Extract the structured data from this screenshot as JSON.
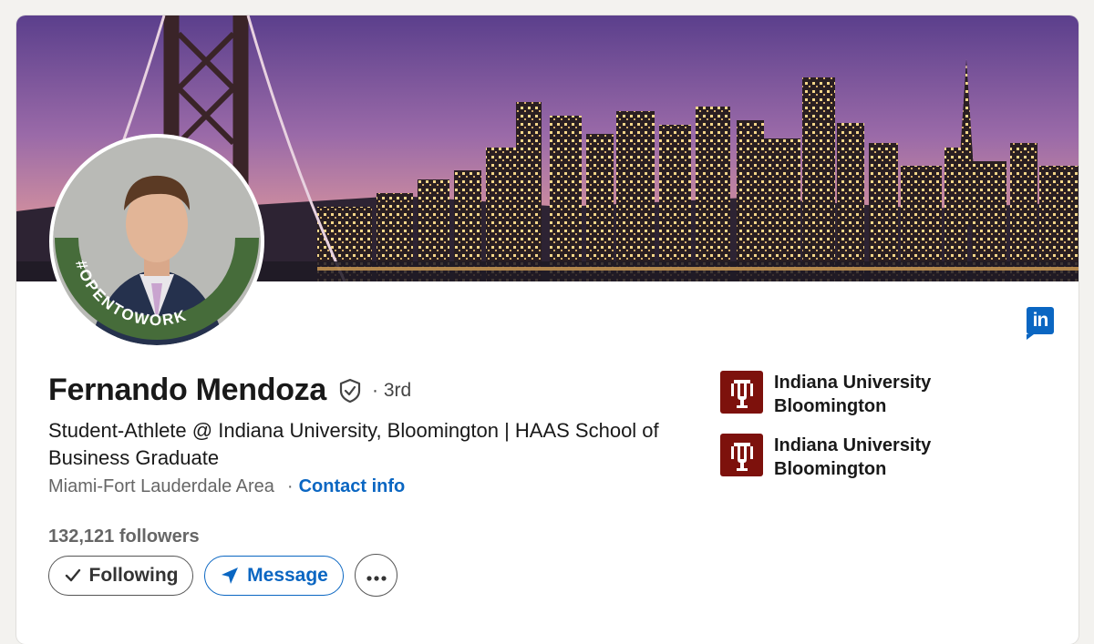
{
  "profile": {
    "name": "Fernando Mendoza",
    "degree": "· 3rd",
    "headline": "Student-Athlete @ Indiana University, Bloomington |  HAAS School of Business Graduate",
    "location": "Miami-Fort Lauderdale Area",
    "contact_label": "Contact info",
    "followers": "132,121 followers",
    "open_to_work_frame": "#OPENTOWORK"
  },
  "actions": {
    "following_label": "Following",
    "message_label": "Message",
    "more_icon": "ellipsis-icon"
  },
  "education": [
    {
      "name_line1": "Indiana University",
      "name_line2": "Bloomington",
      "logo": "IU"
    },
    {
      "name_line1": "Indiana University",
      "name_line2": "Bloomington",
      "logo": "IU"
    }
  ],
  "brand": {
    "linkedin_badge": "in",
    "linkedin_blue": "#0a66c2",
    "iu_crimson": "#7d110c",
    "open_to_work_green": "#466c3a"
  }
}
